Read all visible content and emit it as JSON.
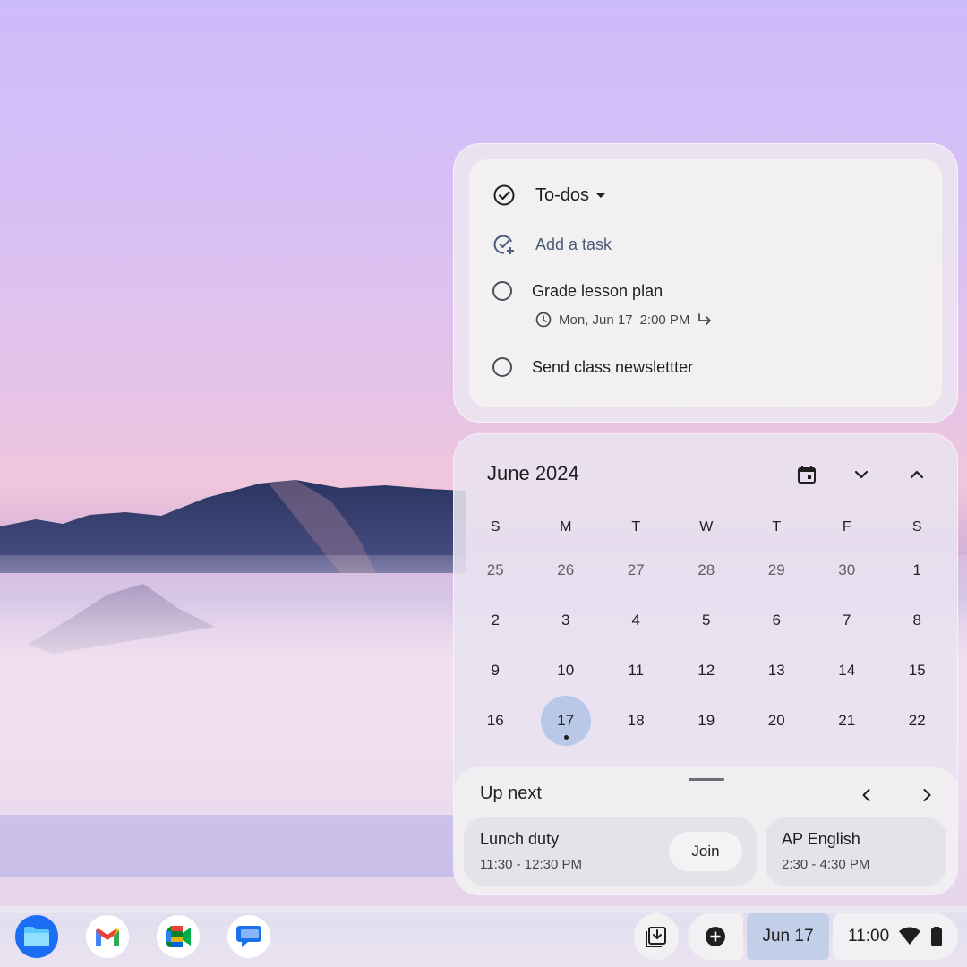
{
  "tasks": {
    "title": "To-dos",
    "add_task": "Add a task",
    "items": [
      {
        "label": "Grade lesson plan",
        "date": "Mon, Jun 17",
        "time": "2:00 PM"
      },
      {
        "label": "Send class newslettter"
      }
    ]
  },
  "calendar": {
    "month": "June 2024",
    "weekdays": [
      "S",
      "M",
      "T",
      "W",
      "T",
      "F",
      "S"
    ],
    "weeks": [
      [
        "25",
        "26",
        "27",
        "28",
        "29",
        "30",
        "1"
      ],
      [
        "2",
        "3",
        "4",
        "5",
        "6",
        "7",
        "8"
      ],
      [
        "9",
        "10",
        "11",
        "12",
        "13",
        "14",
        "15"
      ],
      [
        "16",
        "17",
        "18",
        "19",
        "20",
        "21",
        "22"
      ]
    ],
    "today": "17"
  },
  "up_next": {
    "title": "Up next",
    "events": [
      {
        "title": "Lunch duty",
        "time": "11:30 - 12:30 PM",
        "action": "Join"
      },
      {
        "title": "AP English",
        "time": "2:30 - 4:30 PM"
      }
    ]
  },
  "shelf": {
    "apps": [
      "files-icon",
      "gmail-icon",
      "meet-icon",
      "messages-icon"
    ],
    "date": "Jun 17",
    "time": "11:00"
  },
  "colors": {
    "today_highlight": "#b9c8e6",
    "date_chip": "#c3cfe8"
  }
}
